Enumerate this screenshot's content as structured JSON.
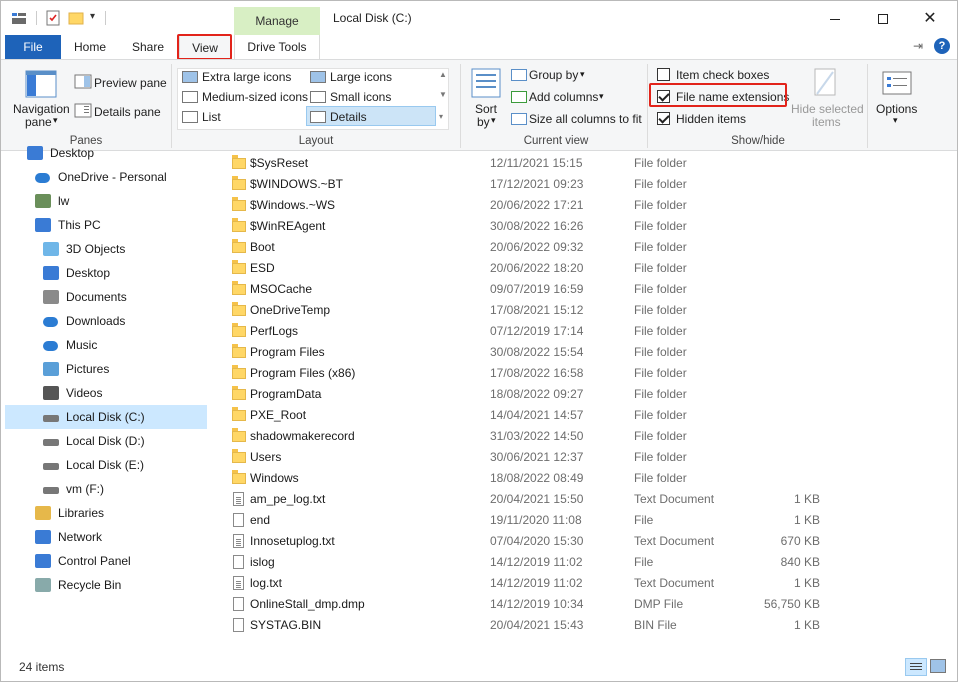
{
  "window": {
    "title": "Local Disk (C:)",
    "manage_tab": "Manage"
  },
  "tabs": {
    "file": "File",
    "home": "Home",
    "share": "Share",
    "view": "View",
    "drive_tools": "Drive Tools"
  },
  "ribbon": {
    "panes": {
      "label": "Panes",
      "navigation_pane": "Navigation",
      "navigation_pane_2": "pane",
      "preview_pane": "Preview pane",
      "details_pane": "Details pane"
    },
    "layout": {
      "label": "Layout",
      "extra_large_icons": "Extra large icons",
      "large_icons": "Large icons",
      "medium_icons": "Medium-sized icons",
      "small_icons": "Small icons",
      "list": "List",
      "details": "Details"
    },
    "current_view": {
      "label": "Current view",
      "sort_by": "Sort",
      "sort_by_2": "by",
      "group_by": "Group by",
      "add_columns": "Add columns",
      "size_columns": "Size all columns to fit"
    },
    "show_hide": {
      "label": "Show/hide",
      "item_check_boxes": "Item check boxes",
      "file_name_extensions": "File name extensions",
      "hidden_items": "Hidden items",
      "hide_selected": "Hide selected",
      "hide_selected_2": "items"
    },
    "options": {
      "label": "Options"
    }
  },
  "nav": [
    {
      "label": "Desktop",
      "icon": "desktop-icon"
    },
    {
      "label": "OneDrive - Personal",
      "icon": "onedrive-icon"
    },
    {
      "label": "lw",
      "icon": "user-icon"
    },
    {
      "label": "This PC",
      "icon": "pc-icon"
    },
    {
      "label": "3D Objects",
      "icon": "3d-objects-icon"
    },
    {
      "label": "Desktop",
      "icon": "desktop-icon"
    },
    {
      "label": "Documents",
      "icon": "documents-icon"
    },
    {
      "label": "Downloads",
      "icon": "downloads-icon"
    },
    {
      "label": "Music",
      "icon": "music-icon"
    },
    {
      "label": "Pictures",
      "icon": "pictures-icon"
    },
    {
      "label": "Videos",
      "icon": "videos-icon"
    },
    {
      "label": "Local Disk (C:)",
      "icon": "drive-icon"
    },
    {
      "label": "Local Disk (D:)",
      "icon": "drive-icon"
    },
    {
      "label": "Local Disk (E:)",
      "icon": "drive-icon"
    },
    {
      "label": "vm (F:)",
      "icon": "drive-icon"
    },
    {
      "label": "Libraries",
      "icon": "libraries-icon"
    },
    {
      "label": "Network",
      "icon": "network-icon"
    },
    {
      "label": "Control Panel",
      "icon": "control-panel-icon"
    },
    {
      "label": "Recycle Bin",
      "icon": "recycle-bin-icon"
    }
  ],
  "files": [
    {
      "name": "$SysReset",
      "date": "12/11/2021 15:15",
      "type": "File folder",
      "size": "",
      "kind": "folder"
    },
    {
      "name": "$WINDOWS.~BT",
      "date": "17/12/2021 09:23",
      "type": "File folder",
      "size": "",
      "kind": "folder"
    },
    {
      "name": "$Windows.~WS",
      "date": "20/06/2022 17:21",
      "type": "File folder",
      "size": "",
      "kind": "folder"
    },
    {
      "name": "$WinREAgent",
      "date": "30/08/2022 16:26",
      "type": "File folder",
      "size": "",
      "kind": "folder"
    },
    {
      "name": "Boot",
      "date": "20/06/2022 09:32",
      "type": "File folder",
      "size": "",
      "kind": "folder"
    },
    {
      "name": "ESD",
      "date": "20/06/2022 18:20",
      "type": "File folder",
      "size": "",
      "kind": "folder"
    },
    {
      "name": "MSOCache",
      "date": "09/07/2019 16:59",
      "type": "File folder",
      "size": "",
      "kind": "folder"
    },
    {
      "name": "OneDriveTemp",
      "date": "17/08/2021 15:12",
      "type": "File folder",
      "size": "",
      "kind": "folder"
    },
    {
      "name": "PerfLogs",
      "date": "07/12/2019 17:14",
      "type": "File folder",
      "size": "",
      "kind": "folder"
    },
    {
      "name": "Program Files",
      "date": "30/08/2022 15:54",
      "type": "File folder",
      "size": "",
      "kind": "folder"
    },
    {
      "name": "Program Files (x86)",
      "date": "17/08/2022 16:58",
      "type": "File folder",
      "size": "",
      "kind": "folder"
    },
    {
      "name": "ProgramData",
      "date": "18/08/2022 09:27",
      "type": "File folder",
      "size": "",
      "kind": "folder"
    },
    {
      "name": "PXE_Root",
      "date": "14/04/2021 14:57",
      "type": "File folder",
      "size": "",
      "kind": "folder"
    },
    {
      "name": "shadowmakerecord",
      "date": "31/03/2022 14:50",
      "type": "File folder",
      "size": "",
      "kind": "folder"
    },
    {
      "name": "Users",
      "date": "30/06/2021 12:37",
      "type": "File folder",
      "size": "",
      "kind": "folder"
    },
    {
      "name": "Windows",
      "date": "18/08/2022 08:49",
      "type": "File folder",
      "size": "",
      "kind": "folder"
    },
    {
      "name": "am_pe_log.txt",
      "date": "20/04/2021 15:50",
      "type": "Text Document",
      "size": "1 KB",
      "kind": "txt"
    },
    {
      "name": "end",
      "date": "19/11/2020 11:08",
      "type": "File",
      "size": "1 KB",
      "kind": "file"
    },
    {
      "name": "Innosetuplog.txt",
      "date": "07/04/2020 15:30",
      "type": "Text Document",
      "size": "670 KB",
      "kind": "txt"
    },
    {
      "name": "islog",
      "date": "14/12/2019 11:02",
      "type": "File",
      "size": "840 KB",
      "kind": "file"
    },
    {
      "name": "log.txt",
      "date": "14/12/2019 11:02",
      "type": "Text Document",
      "size": "1 KB",
      "kind": "txt"
    },
    {
      "name": "OnlineStall_dmp.dmp",
      "date": "14/12/2019 10:34",
      "type": "DMP File",
      "size": "56,750 KB",
      "kind": "file"
    },
    {
      "name": "SYSTAG.BIN",
      "date": "20/04/2021 15:43",
      "type": "BIN File",
      "size": "1 KB",
      "kind": "file"
    }
  ],
  "status": {
    "item_count": "24 items"
  },
  "colors": {
    "accent": "#1e63b9",
    "highlight": "#e2231a",
    "selection": "#cce8ff",
    "manage_tab": "#d8efc4"
  }
}
